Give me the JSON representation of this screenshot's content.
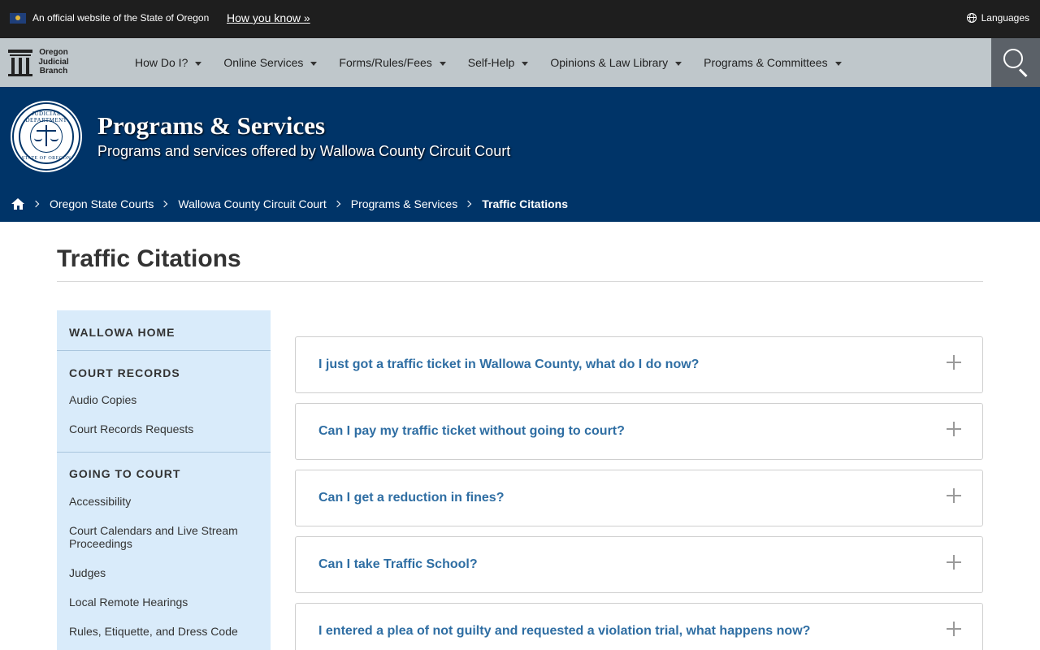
{
  "gov_banner": {
    "official_text": "An official website of the State of Oregon",
    "how_you_know": "How you know »",
    "languages": "Languages"
  },
  "nav": {
    "logo_lines": [
      "Oregon",
      "Judicial",
      "Branch"
    ],
    "items": [
      {
        "label": "How Do I?"
      },
      {
        "label": "Online Services"
      },
      {
        "label": "Forms/Rules/Fees"
      },
      {
        "label": "Self-Help"
      },
      {
        "label": "Opinions & Law Library"
      },
      {
        "label": "Programs & Committees"
      }
    ]
  },
  "hero": {
    "title": "Programs & Services",
    "subtitle": "Programs and services offered by Wallowa County Circuit Court",
    "seal_top": "JUDICIAL DEPARTMENT",
    "seal_bottom": "STATE OF OREGON"
  },
  "breadcrumb": [
    {
      "label": "Oregon State Courts"
    },
    {
      "label": "Wallowa County Circuit Court"
    },
    {
      "label": "Programs & Services"
    },
    {
      "label": "Traffic Citations"
    }
  ],
  "page": {
    "title": "Traffic Citations"
  },
  "sidebar": {
    "home": "WALLOWA HOME",
    "sections": [
      {
        "heading": "COURT RECORDS",
        "links": [
          "Audio Copies",
          "Court Records Requests"
        ]
      },
      {
        "heading": "GOING TO COURT",
        "links": [
          "Accessibility",
          "Court Calendars and Live Stream Proceedings",
          "Judges",
          "Local Remote Hearings",
          "Rules, Etiquette, and Dress Code"
        ]
      }
    ]
  },
  "faq": [
    {
      "question": "I just got a traffic ticket in Wallowa County, what do I do now?"
    },
    {
      "question": "Can I pay my traffic ticket without going to court?"
    },
    {
      "question": "Can I get a reduction in fines?"
    },
    {
      "question": "Can I take Traffic School?"
    },
    {
      "question": "I entered a plea of not guilty and requested a violation trial, what happens now?"
    }
  ]
}
